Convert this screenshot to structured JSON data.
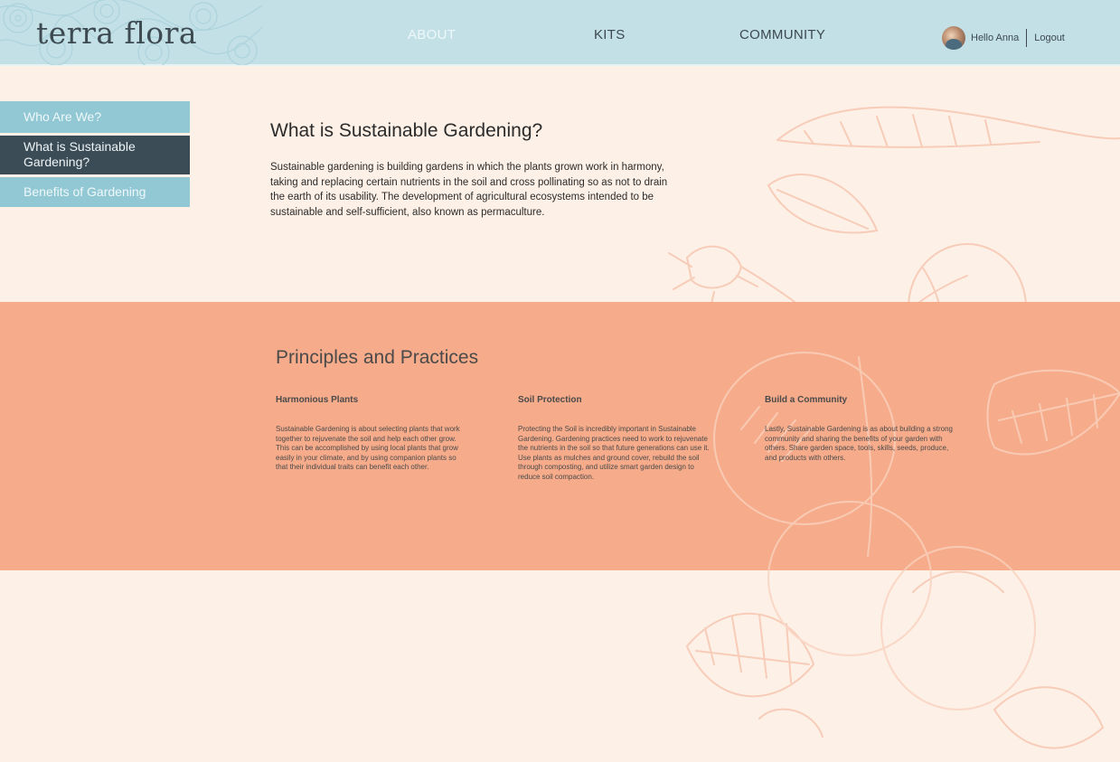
{
  "header": {
    "logo": "terra flora",
    "nav": [
      "ABOUT",
      "KITS",
      "COMMUNITY"
    ],
    "active_nav": "ABOUT",
    "greeting": "Hello Anna",
    "logout": "Logout"
  },
  "sidebar": {
    "items": [
      {
        "label": "Who Are We?"
      },
      {
        "label": "What is Sustainable Gardening?"
      },
      {
        "label": "Benefits of Gardening"
      }
    ],
    "active": "What is Sustainable Gardening?"
  },
  "intro": {
    "title": "What is Sustainable Gardening?",
    "body": "Sustainable gardening is building gardens in which the plants grown work in harmony, taking and replacing certain nutrients in the soil and cross pollinating so as not to drain the earth of its usability. The development of agricultural ecosystems intended to be sustainable and self-sufficient, also known as permaculture."
  },
  "principles": {
    "title": "Principles and Practices",
    "columns": [
      {
        "heading": "Harmonious Plants",
        "body": "Sustainable Gardening is about selecting plants that work together to rejuvenate the soil and help each other grow. This can be accomplished by using local plants that grow easily in your climate, and by using companion plants so that their individual traits can benefit each other."
      },
      {
        "heading": "Soil Protection",
        "body": "Protecting the Soil is incredibly important in Sustainable Gardening. Gardening practices need to work to rejuvenate the nutrients in the soil so that future generations can use it. Use plants as mulches and ground cover, rebuild the soil through composting, and utilize smart garden design to reduce soil compaction."
      },
      {
        "heading": "Build a Community",
        "body": "Lastly, Sustainable Gardening is as about building a strong community and sharing the benefits of your garden with others. Share garden space, tools, skills, seeds, produce, and products with others."
      }
    ]
  },
  "colors": {
    "header_bg": "#c2e0e6",
    "page_bg": "#fdf0e6",
    "band_bg": "#f6ac8b",
    "sidebar_active": "#3c4c57",
    "sidebar_item": "#92c8d4"
  },
  "icons": [
    "avatar",
    "floral-pattern",
    "botanical-illustration"
  ]
}
